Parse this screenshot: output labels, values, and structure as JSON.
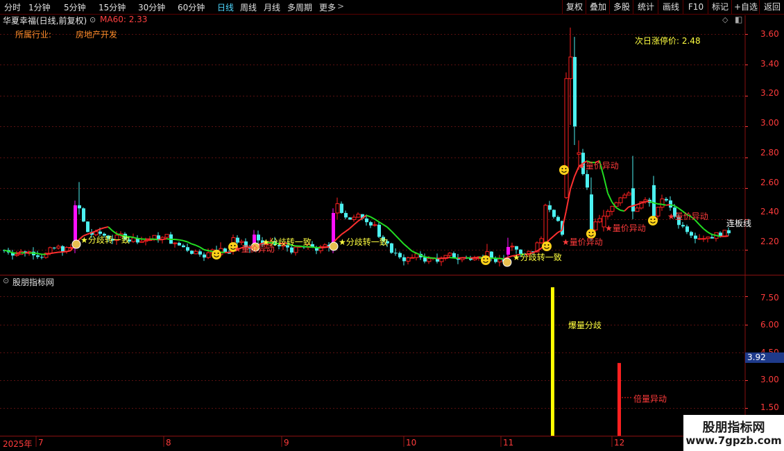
{
  "toolbar": {
    "period_tabs": [
      "分时",
      "1分钟",
      "5分钟",
      "15分钟",
      "30分钟",
      "60分钟",
      "日线",
      "周线",
      "月线",
      "多周期",
      "更多"
    ],
    "more_arrow": ">",
    "right_buttons": [
      "复权",
      "叠加",
      "多股",
      "统计",
      "画线",
      "F10",
      "标记",
      "+自选",
      "返回"
    ]
  },
  "header": {
    "stock_title": "华夏幸福(日线,前复权)",
    "ma_label": "MA60: 2.33",
    "industry_label": "所属行业:",
    "industry_value": "房地产开发",
    "limit_up_text": "次日涨停价: 2.48"
  },
  "colors": {
    "up": "#ff2020",
    "down": "#4cf0f0",
    "ma_up": "#ff3030",
    "ma_down": "#22dd22",
    "magenta": "#ff10ff",
    "yellow": "#ffff00",
    "price_axis": "#ff3b3b",
    "grid": "#5a1010"
  },
  "main_axis": {
    "tick_labels": [
      "3.60",
      "3.40",
      "3.20",
      "3.00",
      "2.80",
      "2.60",
      "2.40",
      "2.20"
    ],
    "ylim": [
      2.04,
      3.72
    ]
  },
  "annotations": {
    "divergence_1": "★分歧转一致",
    "divergence_2": "★分歧转一致",
    "divergence_3": "★分歧转一致",
    "divergence_4": "★分歧转一致",
    "vol_anomaly_1": "★量价异动",
    "vol_anomaly_2": "★量价异动",
    "vol_anomaly_3": "★量价异动",
    "vol_anomaly_4": "★量价异动",
    "vol_anomaly_5": "★量价异动",
    "consecutive": "连板线"
  },
  "sub_panel": {
    "title": "股朋指标网",
    "tick_labels": [
      "7.50",
      "6.00",
      "4.50",
      "3.00",
      "1.50"
    ],
    "current_value": "3.92",
    "bar1_label": "爆量分歧",
    "bar2_label": "倍量异动",
    "ylim": [
      0,
      8.6
    ],
    "bar1_value": 8.0,
    "bar2_value": 3.92
  },
  "date_axis": {
    "year_label": "2025年",
    "months": [
      "7",
      "8",
      "9",
      "10",
      "11",
      "12"
    ]
  },
  "watermark": {
    "line1": "股朋指标网",
    "line2": "www.7gpzb.com"
  }
}
